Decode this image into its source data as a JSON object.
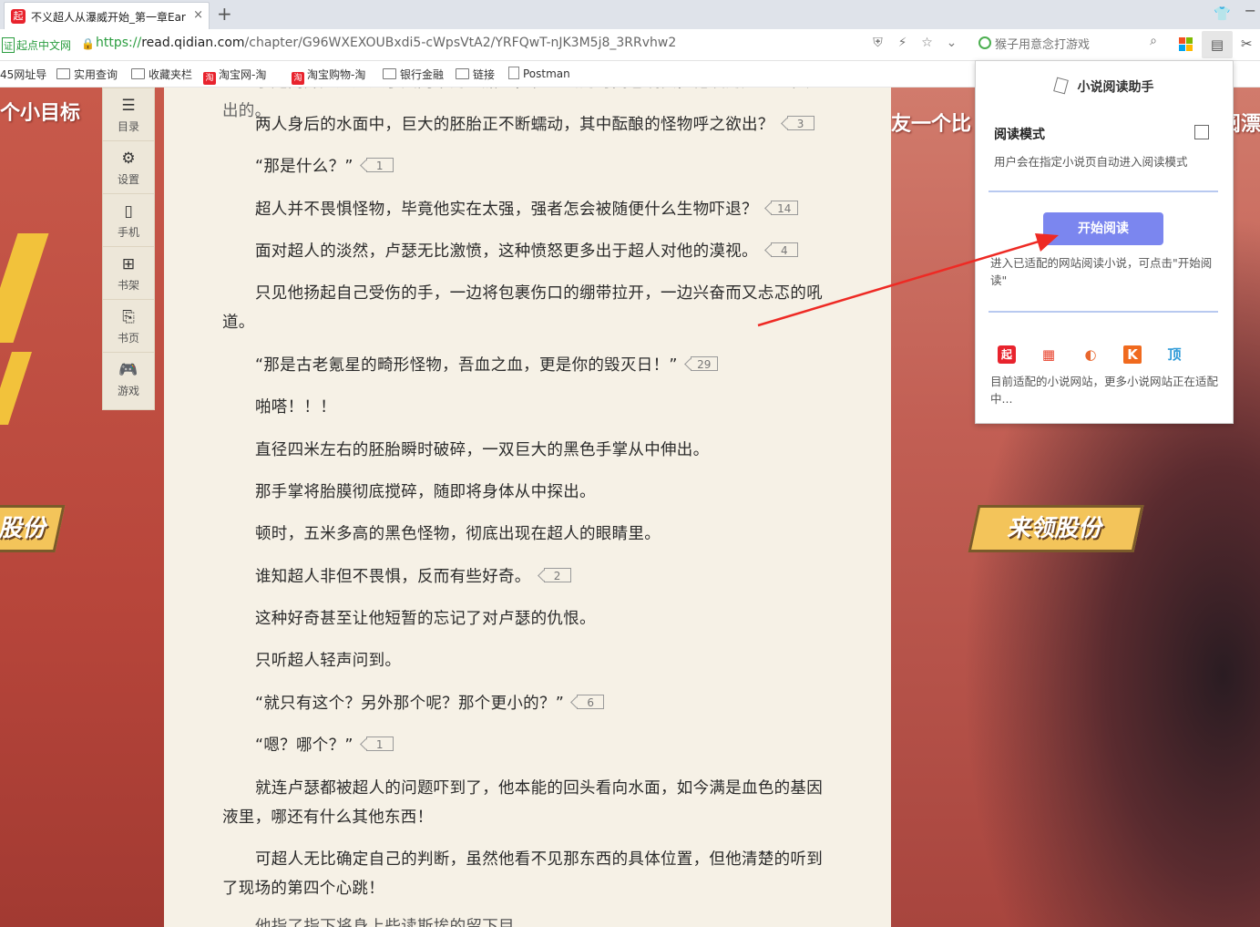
{
  "tab": {
    "title": "不义超人从瀑威开始_第一章Ear",
    "favicon": "起",
    "close": "×"
  },
  "newtab": "+",
  "address": {
    "cert": "起点中文网",
    "cert_box": "证",
    "url_proto": "https://",
    "url_host": "read.qidian.com",
    "url_path": "/chapter/G96WXEXOUBxdi5-cWpsVtA2/YRFQwT-nJK3M5j8_3RRvhw2",
    "search_placeholder": "猴子用意念打游戏"
  },
  "bookmarks": [
    {
      "label": "45网址导",
      "type": "text"
    },
    {
      "label": "实用查询",
      "type": "folder"
    },
    {
      "label": "收藏夹栏",
      "type": "folder"
    },
    {
      "label": "淘宝网-淘",
      "type": "taobao"
    },
    {
      "label": "淘宝购物-淘",
      "type": "taobao"
    },
    {
      "label": "银行金融",
      "type": "folder"
    },
    {
      "label": "链接",
      "type": "folder"
    },
    {
      "label": "Postman",
      "type": "page"
    }
  ],
  "sidetool": [
    {
      "label": "目录",
      "icon": "list-icon",
      "glyph": "☰"
    },
    {
      "label": "设置",
      "icon": "gear-icon",
      "glyph": "⚙"
    },
    {
      "label": "手机",
      "icon": "phone-icon",
      "glyph": "▯"
    },
    {
      "label": "书架",
      "icon": "bookshelf-icon",
      "glyph": "⊞"
    },
    {
      "label": "书页",
      "icon": "bookpage-icon",
      "glyph": "⎘"
    },
    {
      "label": "游戏",
      "icon": "gamepad-icon",
      "glyph": "🎮"
    }
  ],
  "banner": {
    "left_top": "个小目标",
    "right_top": "友一个比",
    "right_top2": "阅漂",
    "promo_left": "股份",
    "promo_right": "来领股份"
  },
  "paragraphs": [
    {
      "text": "两人身后的水面中，巨大的胚胎正不断蠕动，其中酝酿的怪物呼之欲出？",
      "count": "3"
    },
    {
      "text": "“那是什么？”",
      "count": "1"
    },
    {
      "text": "超人并不畏惧怪物，毕竟他实在太强，强者怎会被随便什么生物吓退？",
      "count": "14"
    },
    {
      "text": "面对超人的淡然，卢瑟无比激愤，这种愤怒更多出于超人对他的漠视。",
      "count": "4"
    },
    {
      "text": "只见他扬起自己受伤的手，一边将包裹伤口的绷带拉开，一边兴奋而又忐忑的吼道。",
      "count": ""
    },
    {
      "text": "“那是古老氪星的畸形怪物，吾血之血，更是你的毁灭日！”",
      "count": "29"
    },
    {
      "text": "啪嗒！！！",
      "count": ""
    },
    {
      "text": "直径四米左右的胚胎瞬时破碎，一双巨大的黑色手掌从中伸出。",
      "count": ""
    },
    {
      "text": "那手掌将胎膜彻底搅碎，随即将身体从中探出。",
      "count": ""
    },
    {
      "text": "顿时，五米多高的黑色怪物，彻底出现在超人的眼睛里。",
      "count": ""
    },
    {
      "text": "谁知超人非但不畏惧，反而有些好奇。",
      "count": "2"
    },
    {
      "text": "这种好奇甚至让他短暂的忘记了对卢瑟的仇恨。",
      "count": ""
    },
    {
      "text": "只听超人轻声问到。",
      "count": ""
    },
    {
      "text": "“就只有这个？另外那个呢？那个更小的？”",
      "count": "6"
    },
    {
      "text": "“嗯？哪个？”",
      "count": "1"
    },
    {
      "text": "就连卢瑟都被超人的问题吓到了，他本能的回头看向水面，如今满是血色的基因液里，哪还有什么其他东西！",
      "count": ""
    },
    {
      "text": "可超人无比确定自己的判断，虽然他看不见那东西的具体位置，但他清楚的听到了现场的第四个心跳！",
      "count": ""
    }
  ],
  "partial_top": "于是离开延迟进入了大门中的飞船里，在过去的时间也确实，他叹的超人正在超出的。",
  "partial_bottom": "他指了指下将身上些读斯埃的留下目",
  "popup": {
    "title": "小说阅读助手",
    "reading_mode_label": "阅读模式",
    "reading_mode_checked": false,
    "reading_mode_desc": "用户会在指定小说页自动进入阅读模式",
    "start_button": "开始阅读",
    "start_desc": "进入已适配的网站阅读小说，可点击\"开始阅读\"",
    "sites": [
      {
        "glyph": "起",
        "icon": "qidian-icon",
        "color": "#e8232d"
      },
      {
        "glyph": "▦",
        "icon": "zongheng-icon",
        "color": "#e8422d"
      },
      {
        "glyph": "◐",
        "icon": "xxsy-icon",
        "color": "#e8662d"
      },
      {
        "glyph": "K",
        "icon": "kanshu-icon",
        "color": "#f06a1e"
      },
      {
        "glyph": "顶",
        "icon": "dingdian-icon",
        "color": "#2f9bd8"
      }
    ],
    "sites_desc": "目前适配的小说网站，更多小说网站正在适配中..."
  }
}
